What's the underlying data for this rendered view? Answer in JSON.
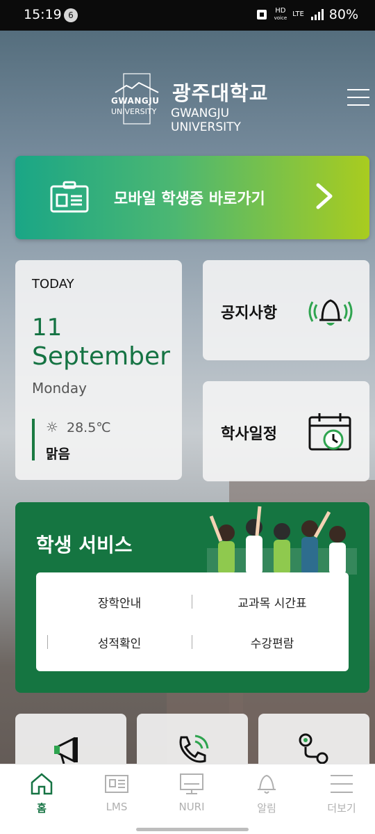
{
  "status_bar": {
    "time": "15:19",
    "notif_count": "6",
    "hd": "HD",
    "volte": "voice",
    "lte": "LTE",
    "battery": "80%"
  },
  "header": {
    "logo_en_top": "GWANGJU",
    "logo_en_bottom": "UNIVERSITY",
    "title_ko": "광주대학교",
    "title_en": "GWANGJU UNIVERSITY"
  },
  "banner": {
    "label": "모바일 학생증 바로가기"
  },
  "today": {
    "label": "TODAY",
    "day": "11",
    "month": "September",
    "weekday": "Monday",
    "temperature": "28.5℃",
    "condition": "맑음"
  },
  "cards": {
    "notice": "공지사항",
    "schedule": "학사일정"
  },
  "student_services": {
    "title": "학생 서비스",
    "items": [
      "장학안내",
      "교과목 시간표",
      "성적확인",
      "수강편람"
    ]
  },
  "quick_tiles": [
    "megaphone-icon",
    "phone-icon",
    "route-icon"
  ],
  "bottom_nav": [
    {
      "label": "홈",
      "icon": "home-icon",
      "active": true
    },
    {
      "label": "LMS",
      "icon": "lms-icon",
      "active": false
    },
    {
      "label": "NURI",
      "icon": "nuri-icon",
      "active": false
    },
    {
      "label": "알림",
      "icon": "bell-icon",
      "active": false
    },
    {
      "label": "더보기",
      "icon": "menu-icon",
      "active": false
    }
  ],
  "colors": {
    "brand_green": "#157343",
    "banner_start": "#1aa686",
    "banner_end": "#a9cc1f"
  }
}
